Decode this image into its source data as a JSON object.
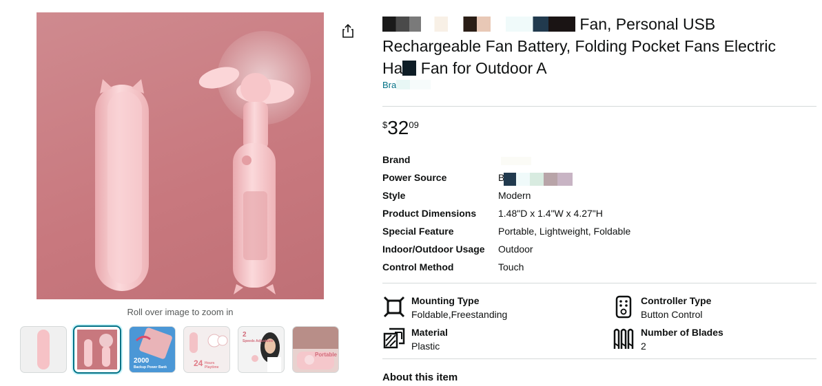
{
  "image_panel": {
    "rollover_text": "Roll over image to zoom in",
    "thumbnails": [
      {
        "id": "thumb-1",
        "text": ""
      },
      {
        "id": "thumb-2",
        "text": ""
      },
      {
        "id": "thumb-3",
        "text": "2000"
      },
      {
        "id": "thumb-4",
        "text": "24"
      },
      {
        "id": "thumb-5",
        "text": "2"
      },
      {
        "id": "thumb-6",
        "text": "Portable"
      }
    ],
    "thumb3_sub": "Backup Power Bank",
    "thumb4_sub": "Hours Playtime",
    "thumb5_sub": "Speeds Adjustable"
  },
  "product": {
    "title_line1_visible": "Fan, Personal USB",
    "title_line2": "Rechargeable Fan Battery, Folding Pocket Fans Electric",
    "title_line3_a": "Ha",
    "title_line3_b": "Fan for Outdoor A",
    "brand_link": "Bra",
    "price": {
      "symbol": "$",
      "whole": "32",
      "fraction": "09"
    }
  },
  "specs": [
    {
      "label": "Brand",
      "value": ""
    },
    {
      "label": "Power Source",
      "value": "B"
    },
    {
      "label": "Style",
      "value": "Modern"
    },
    {
      "label": "Product Dimensions",
      "value": "1.48\"D x 1.4\"W x 4.27\"H"
    },
    {
      "label": "Special Feature",
      "value": "Portable, Lightweight, Foldable"
    },
    {
      "label": "Indoor/Outdoor Usage",
      "value": "Outdoor"
    },
    {
      "label": "Control Method",
      "value": "Touch"
    }
  ],
  "features": [
    {
      "name": "Mounting Type",
      "value": "Foldable,Freestanding",
      "icon": "mounting-icon"
    },
    {
      "name": "Controller Type",
      "value": "Button Control",
      "icon": "remote-icon"
    },
    {
      "name": "Material",
      "value": "Plastic",
      "icon": "material-icon"
    },
    {
      "name": "Number of Blades",
      "value": "2",
      "icon": "blades-icon"
    }
  ],
  "about_heading": "About this item",
  "colors": {
    "link": "#007185",
    "divider": "#d5d9d9",
    "image_bg": "#c8787e",
    "product_pink": "#f6c5c8"
  }
}
